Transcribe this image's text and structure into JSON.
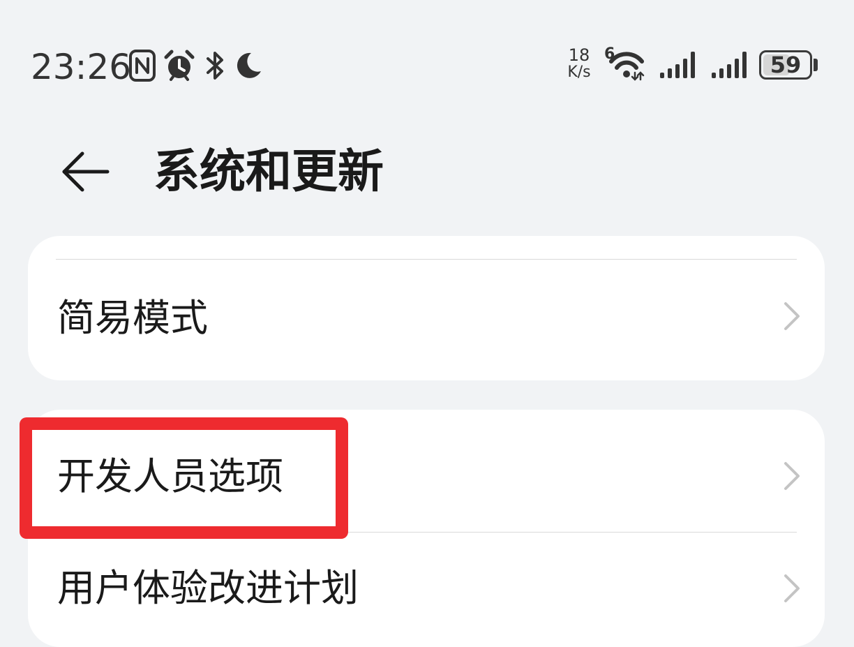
{
  "status_bar": {
    "time": "23:26",
    "net_speed_value": "18",
    "net_speed_unit": "K/s",
    "wifi_badge": "6",
    "battery_level": "59",
    "icons": [
      "nfc-icon",
      "alarm-icon",
      "bluetooth-icon",
      "do-not-disturb-moon-icon",
      "wifi-icon",
      "signal-icon",
      "signal-icon",
      "battery-icon"
    ]
  },
  "header": {
    "title": "系统和更新",
    "back_icon": "back-arrow-icon"
  },
  "groups": [
    {
      "items": [
        {
          "label": "简易模式",
          "icon": "chevron-right-icon"
        }
      ]
    },
    {
      "items": [
        {
          "label": "开发人员选项",
          "icon": "chevron-right-icon",
          "highlighted": true
        },
        {
          "label": "用户体验改进计划",
          "icon": "chevron-right-icon"
        }
      ]
    }
  ],
  "colors": {
    "background": "#f1f3f5",
    "card": "#ffffff",
    "text": "#1a1a1a",
    "chevron": "#c4c4c4",
    "highlight": "#ee2b2f"
  }
}
